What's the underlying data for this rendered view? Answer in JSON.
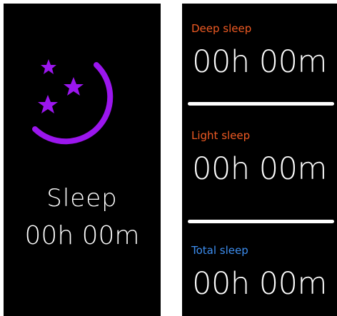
{
  "summary": {
    "title": "Sleep",
    "duration": "00h 00m"
  },
  "details": {
    "deep": {
      "label": "Deep sleep",
      "duration": "00h 00m"
    },
    "light": {
      "label": "Light sleep",
      "duration": "00h 00m"
    },
    "total": {
      "label": "Total sleep",
      "duration": "00h 00m"
    }
  },
  "colors": {
    "icon": "#9b16ee",
    "deep_label": "#ef5a23",
    "light_label": "#ef5a23",
    "total_label": "#3d8ef0"
  },
  "icons": {
    "moon": "moon-crescent-icon",
    "stars": "star-icon"
  }
}
